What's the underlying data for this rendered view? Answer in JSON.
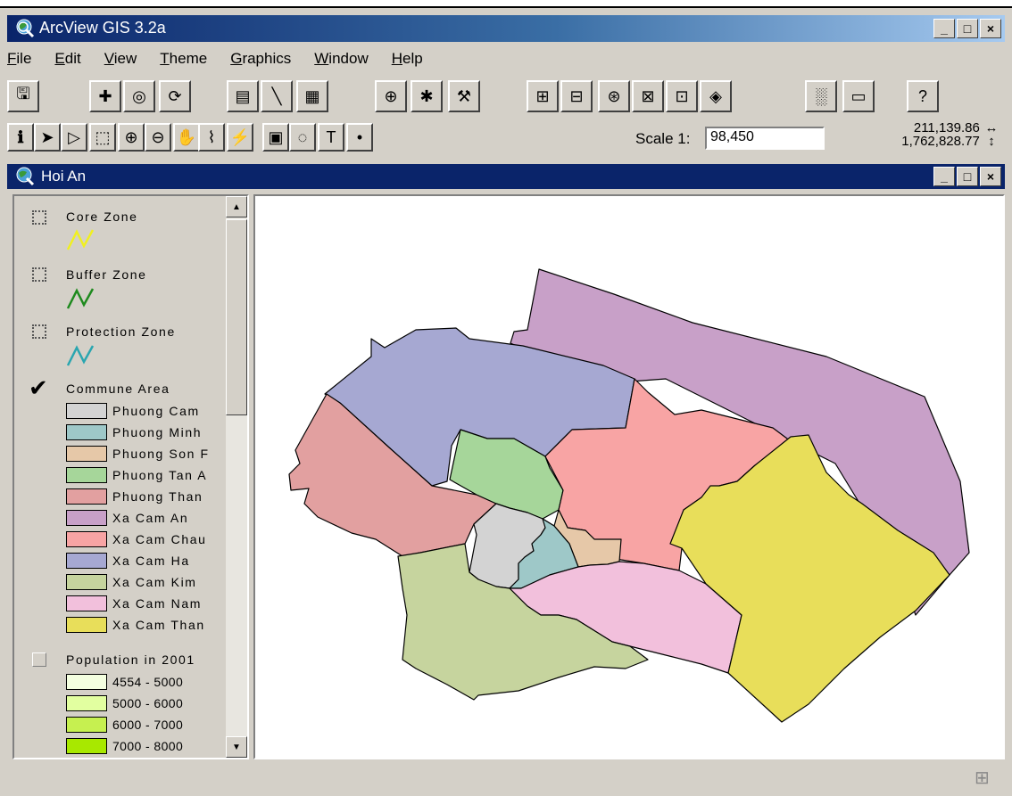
{
  "window": {
    "title": "ArcView GIS 3.2a",
    "buttons": [
      "_",
      "□",
      "×"
    ]
  },
  "menu": [
    "File",
    "Edit",
    "View",
    "Theme",
    "Graphics",
    "Window",
    "Help"
  ],
  "toolbar2": {
    "scale_label": "Scale 1:",
    "scale_value": "98,450",
    "coord_x": "211,139.86",
    "coord_y": "1,762,828.77"
  },
  "view": {
    "title": "Hoi An"
  },
  "legend": {
    "core": {
      "name": "Core Zone",
      "color": "#f0f020"
    },
    "buffer": {
      "name": "Buffer Zone",
      "color": "#1e8a1e"
    },
    "protection": {
      "name": "Protection Zone",
      "color": "#2aa6b0"
    },
    "commune": {
      "name": "Commune Area",
      "classes": [
        {
          "label": "Phuong Cam",
          "color": "#d3d3d3"
        },
        {
          "label": "Phuong Minh",
          "color": "#9ec8c8"
        },
        {
          "label": "Phuong Son F",
          "color": "#e6c8a8"
        },
        {
          "label": "Phuong Tan A",
          "color": "#a6d69a"
        },
        {
          "label": "Phuong Than",
          "color": "#e2a0a0"
        },
        {
          "label": "Xa Cam An",
          "color": "#c8a0c8"
        },
        {
          "label": "Xa Cam Chau",
          "color": "#f8a4a4"
        },
        {
          "label": "Xa Cam Ha",
          "color": "#a6a8d2"
        },
        {
          "label": "Xa Cam Kim",
          "color": "#c6d49e"
        },
        {
          "label": "Xa Cam Nam",
          "color": "#f2c0dc"
        },
        {
          "label": "Xa Cam Than",
          "color": "#e8de5a"
        }
      ]
    },
    "population": {
      "name": "Population in 2001",
      "classes": [
        {
          "label": "4554 - 5000",
          "color": "#f4ffe0"
        },
        {
          "label": "5000 - 6000",
          "color": "#e2ffa0"
        },
        {
          "label": "6000 - 7000",
          "color": "#c6f050"
        },
        {
          "label": "7000 - 8000",
          "color": "#a8e800"
        }
      ]
    }
  },
  "icons": {
    "toolbar1": [
      "save-icon",
      "add-theme-icon",
      "theme-properties-icon",
      "refresh-icon",
      "view-properties-icon",
      "edit-legend-icon",
      "open-table-icon",
      "find-icon",
      "locate-icon",
      "query-builder-icon",
      "zoom-full-icon",
      "zoom-active-icon",
      "zoom-selected-icon",
      "zoom-in-fixed-icon",
      "zoom-out-fixed-icon",
      "zoom-previous-icon",
      "select-none-icon",
      "layout-icon",
      "help-icon"
    ],
    "toolbar2": [
      "identify-icon",
      "pointer-icon",
      "vertex-edit-icon",
      "select-feature-icon",
      "zoom-in-icon",
      "zoom-out-icon",
      "pan-icon",
      "measure-icon",
      "hotlink-icon",
      "area-of-interest-icon",
      "label-icon",
      "text-icon",
      "draw-point-icon"
    ]
  }
}
